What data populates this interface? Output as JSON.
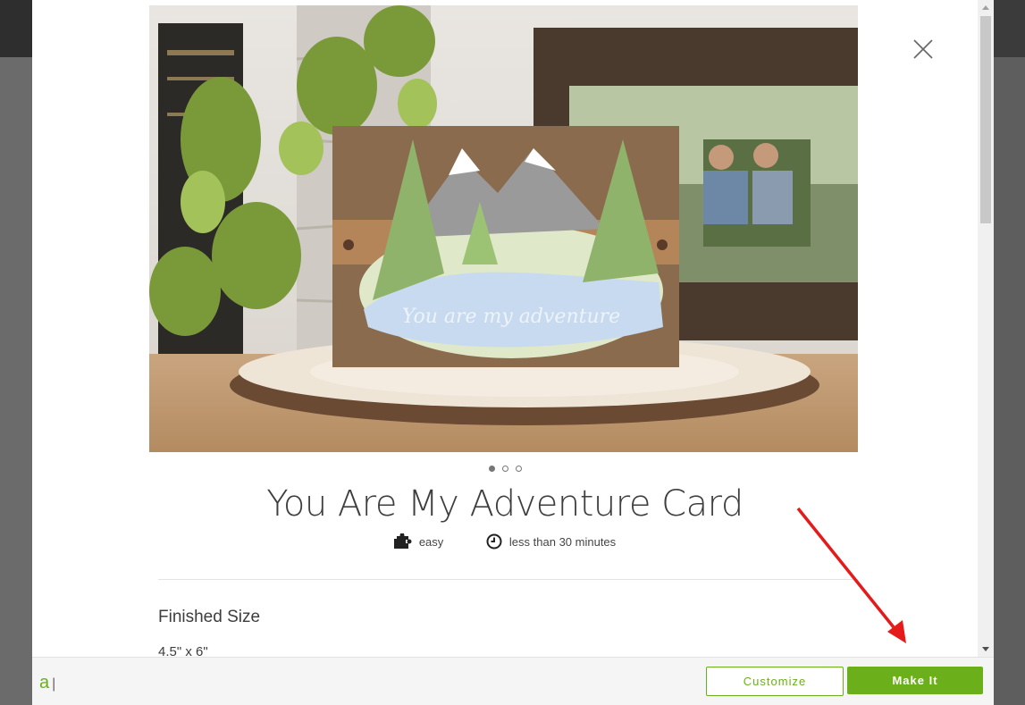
{
  "project": {
    "title": "You Are My Adventure Card",
    "difficulty": "easy",
    "time": "less than 30 minutes"
  },
  "gallery": {
    "total_images": 3,
    "active_index": 0,
    "card_lettering": "You are my adventure"
  },
  "details": {
    "finished_size_label": "Finished Size",
    "finished_size_value": "4.5\" x 6\""
  },
  "footer": {
    "logo_letter": "a",
    "logo_separator": "|",
    "customize_label": "Customize",
    "make_it_label": "Make It"
  },
  "icons": {
    "close": "close-icon",
    "difficulty": "puzzle-icon",
    "time": "clock-icon"
  },
  "colors": {
    "accent": "#6bb01b",
    "annotation": "#e51b1b"
  }
}
